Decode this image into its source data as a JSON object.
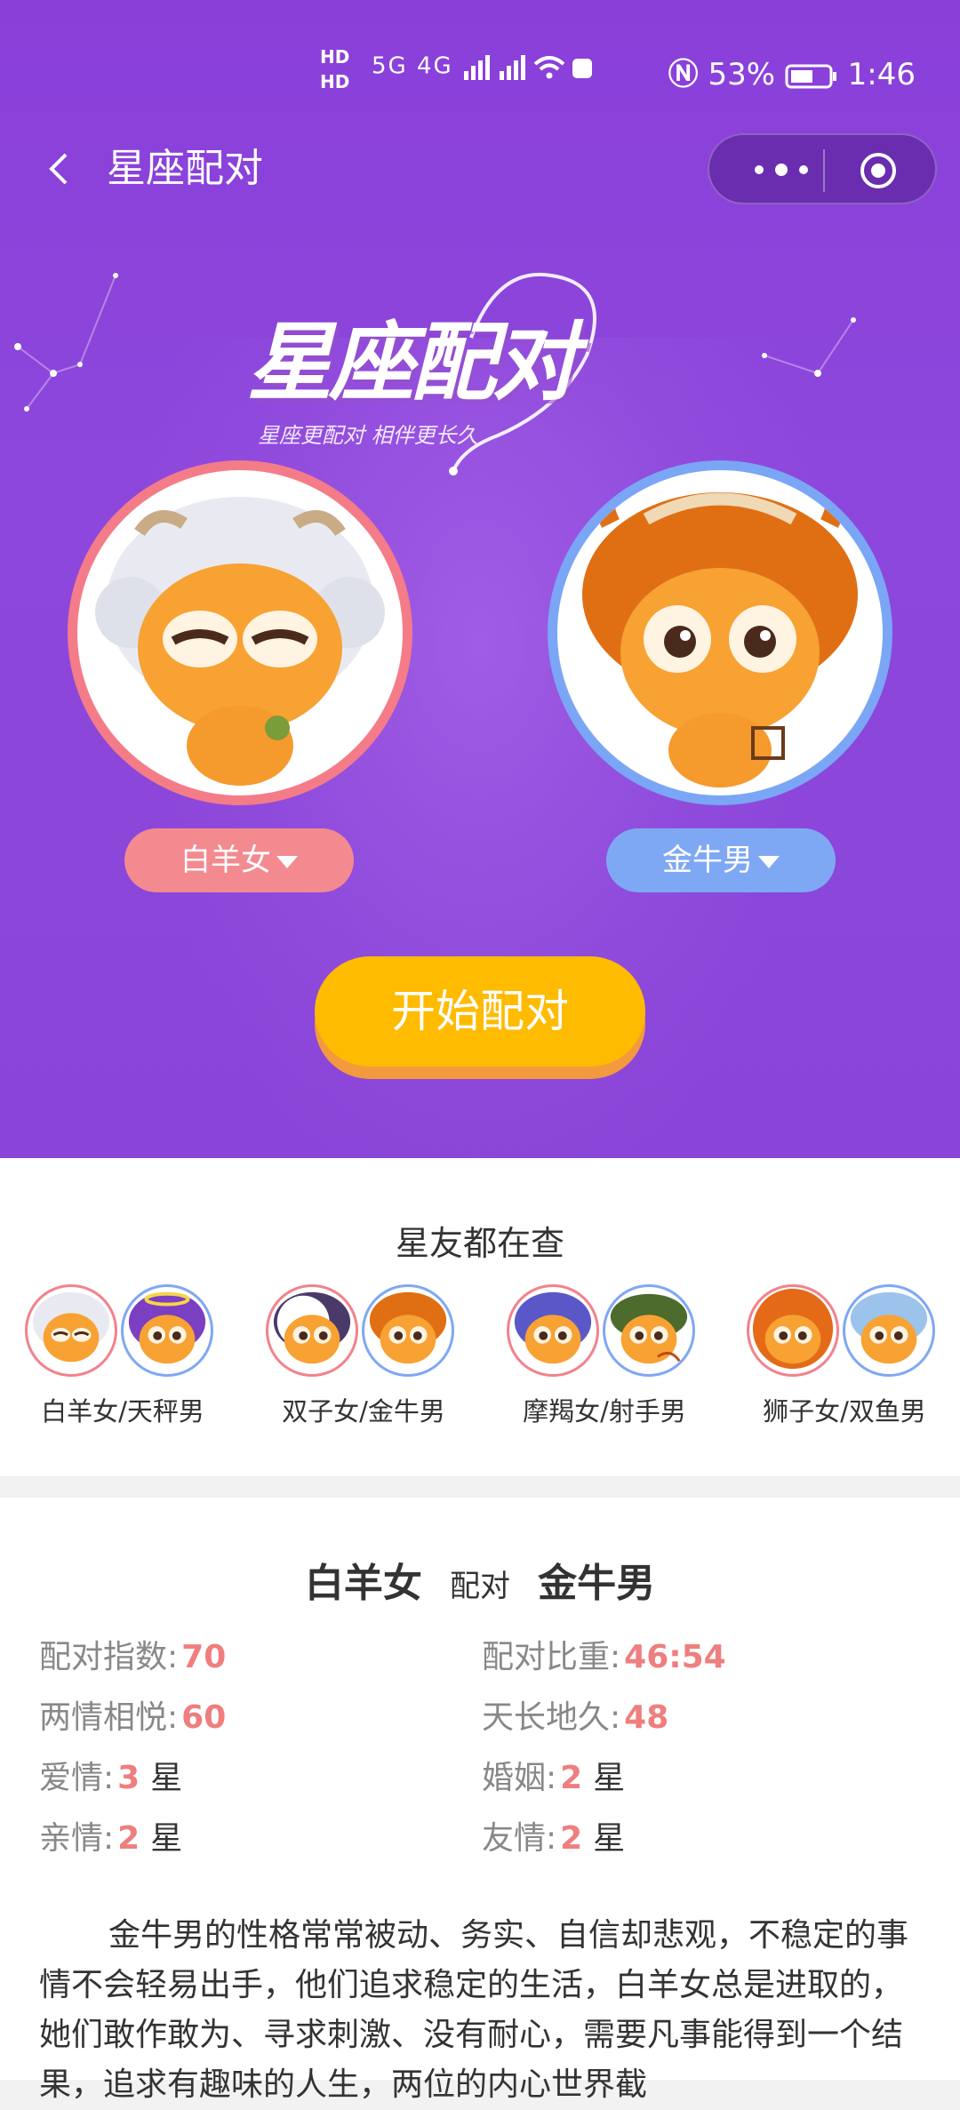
{
  "status_bar": {
    "hd1": "HD",
    "hd2": "HD",
    "network": "5G 4G",
    "battery_percent": "53%",
    "time": "1:46"
  },
  "navbar": {
    "title": "星座配对"
  },
  "hero": {
    "logo_title": "星座配对",
    "logo_subtitle": "星座更配对 相伴更长久",
    "left_select": "白羊女",
    "right_select": "金牛男",
    "start_button": "开始配对"
  },
  "popular": {
    "title": "星友都在查",
    "pairs": [
      {
        "label": "白羊女/天秤男"
      },
      {
        "label": "双子女/金牛男"
      },
      {
        "label": "摩羯女/射手男"
      },
      {
        "label": "狮子女/双鱼男"
      }
    ]
  },
  "result": {
    "female": "白羊女",
    "connector": "配对",
    "male": "金牛男",
    "stats": {
      "index_label": "配对指数:",
      "index_value": "70",
      "ratio_label": "配对比重:",
      "ratio_value": "46:54",
      "joy_label": "两情相悦:",
      "joy_value": "60",
      "forever_label": "天长地久:",
      "forever_value": "48",
      "love_label": "爱情:",
      "love_value": "3",
      "marriage_label": "婚姻:",
      "marriage_value": "2",
      "family_label": "亲情:",
      "family_value": "2",
      "friend_label": "友情:",
      "friend_value": "2",
      "star_unit": "星"
    },
    "description": "金牛男的性格常常被动、务实、自信却悲观，不稳定的事情不会轻易出手，他们追求稳定的生活，白羊女总是进取的，她们敢作敢为、寻求刺激、没有耐心，需要凡事能得到一个结果，追求有趣味的人生，两位的内心世界截"
  },
  "colors": {
    "hero_purple": "#8a3fd9",
    "female_pink": "#f47c88",
    "male_blue": "#7aa6f5",
    "button_yellow": "#ffbb00",
    "value_red": "#ef7e7e"
  }
}
